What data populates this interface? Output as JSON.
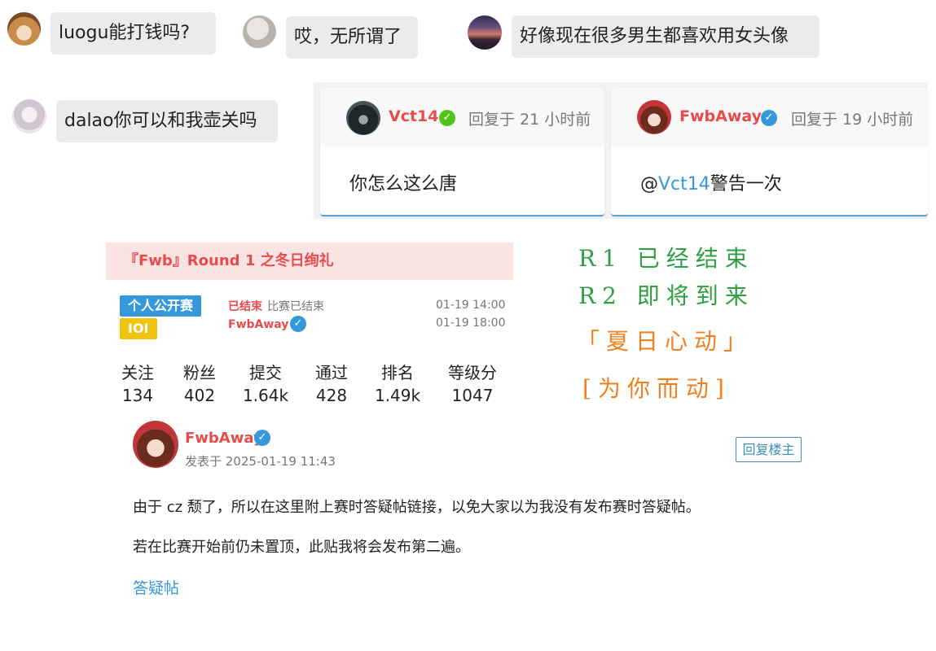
{
  "chat": {
    "messages": [
      {
        "text": "luogu能打钱吗?",
        "avatar": "dog-avatar"
      },
      {
        "text": "哎，无所谓了",
        "avatar": "horse-avatar"
      },
      {
        "text": "好像现在很多男生都喜欢用女头像",
        "avatar": "sunset-avatar"
      },
      {
        "text": "dalao你可以和我壶关吗",
        "avatar": "anime-girl-avatar"
      }
    ]
  },
  "replies": [
    {
      "user": "Vct14",
      "verified_color": "#52c41a",
      "time": "回复于 21 小时前",
      "body": "你怎么这么唐"
    },
    {
      "user": "FwbAway",
      "verified_color": "#3498db",
      "time": "回复于 19 小时前",
      "mention_prefix": "@",
      "mention": "Vct14",
      "body_suffix": "警告一次"
    }
  ],
  "contest": {
    "title": "『Fwb』Round 1 之冬日绚礼",
    "tag_type": "个人公开赛",
    "tag_format": "IOI",
    "status": "已结束",
    "status_detail": "比赛已结束",
    "organizer": "FwbAway",
    "start_time": "01-19 14:00",
    "end_time": "01-19 18:00",
    "colors": {
      "type_tag": "#3498db",
      "format_tag": "#f1c40f",
      "accent": "#e74c4c"
    }
  },
  "stats": [
    {
      "label": "关注",
      "value": "134"
    },
    {
      "label": "粉丝",
      "value": "402"
    },
    {
      "label": "提交",
      "value": "1.64k"
    },
    {
      "label": "通过",
      "value": "428"
    },
    {
      "label": "排名",
      "value": "1.49k"
    },
    {
      "label": "等级分",
      "value": "1047"
    }
  ],
  "handwriting": {
    "line1": "R1 已经结束",
    "line2": "R2 即将到来",
    "line3": "「夏日心动」",
    "line4": "[为你而动]",
    "color_green": "#2ea043",
    "color_orange": "#f08020"
  },
  "post": {
    "author": "FwbAway",
    "meta": "发表于 2025-01-19 11:43",
    "reply_button": "回复楼主",
    "paragraph1": "由于 cz 颓了，所以在这里附上赛时答疑帖链接，以免大家以为我没有发布赛时答疑帖。",
    "paragraph2": "若在比赛开始前仍未置顶，此贴我将会发布第二遍。",
    "link": "答疑帖"
  }
}
